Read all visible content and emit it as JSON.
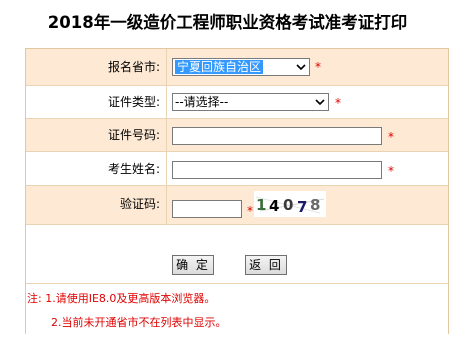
{
  "page": {
    "title": "2018年一级造价工程师职业资格考试准考证打印"
  },
  "form": {
    "province": {
      "label": "报名省市:",
      "selected": "宁夏回族自治区",
      "required_mark": "*"
    },
    "id_type": {
      "label": "证件类型:",
      "selected": "--请选择--",
      "required_mark": "*"
    },
    "id_number": {
      "label": "证件号码:",
      "value": "",
      "required_mark": "*"
    },
    "name": {
      "label": "考生姓名:",
      "value": "",
      "required_mark": "*"
    },
    "captcha": {
      "label": "验证码:",
      "value": "",
      "required_mark": "*",
      "image_text": "14078"
    }
  },
  "buttons": {
    "confirm": "确 定",
    "back": "返 回"
  },
  "notes": {
    "line1": "注: 1.请使用IE8.0及更高版本浏览器。",
    "line2": "2.当前未开通省市不在列表中显示。"
  },
  "colors": {
    "row_tan": "#fde9d4",
    "border": "#e2c8a0",
    "required": "#e00000",
    "select_highlight": "#3399ff"
  }
}
